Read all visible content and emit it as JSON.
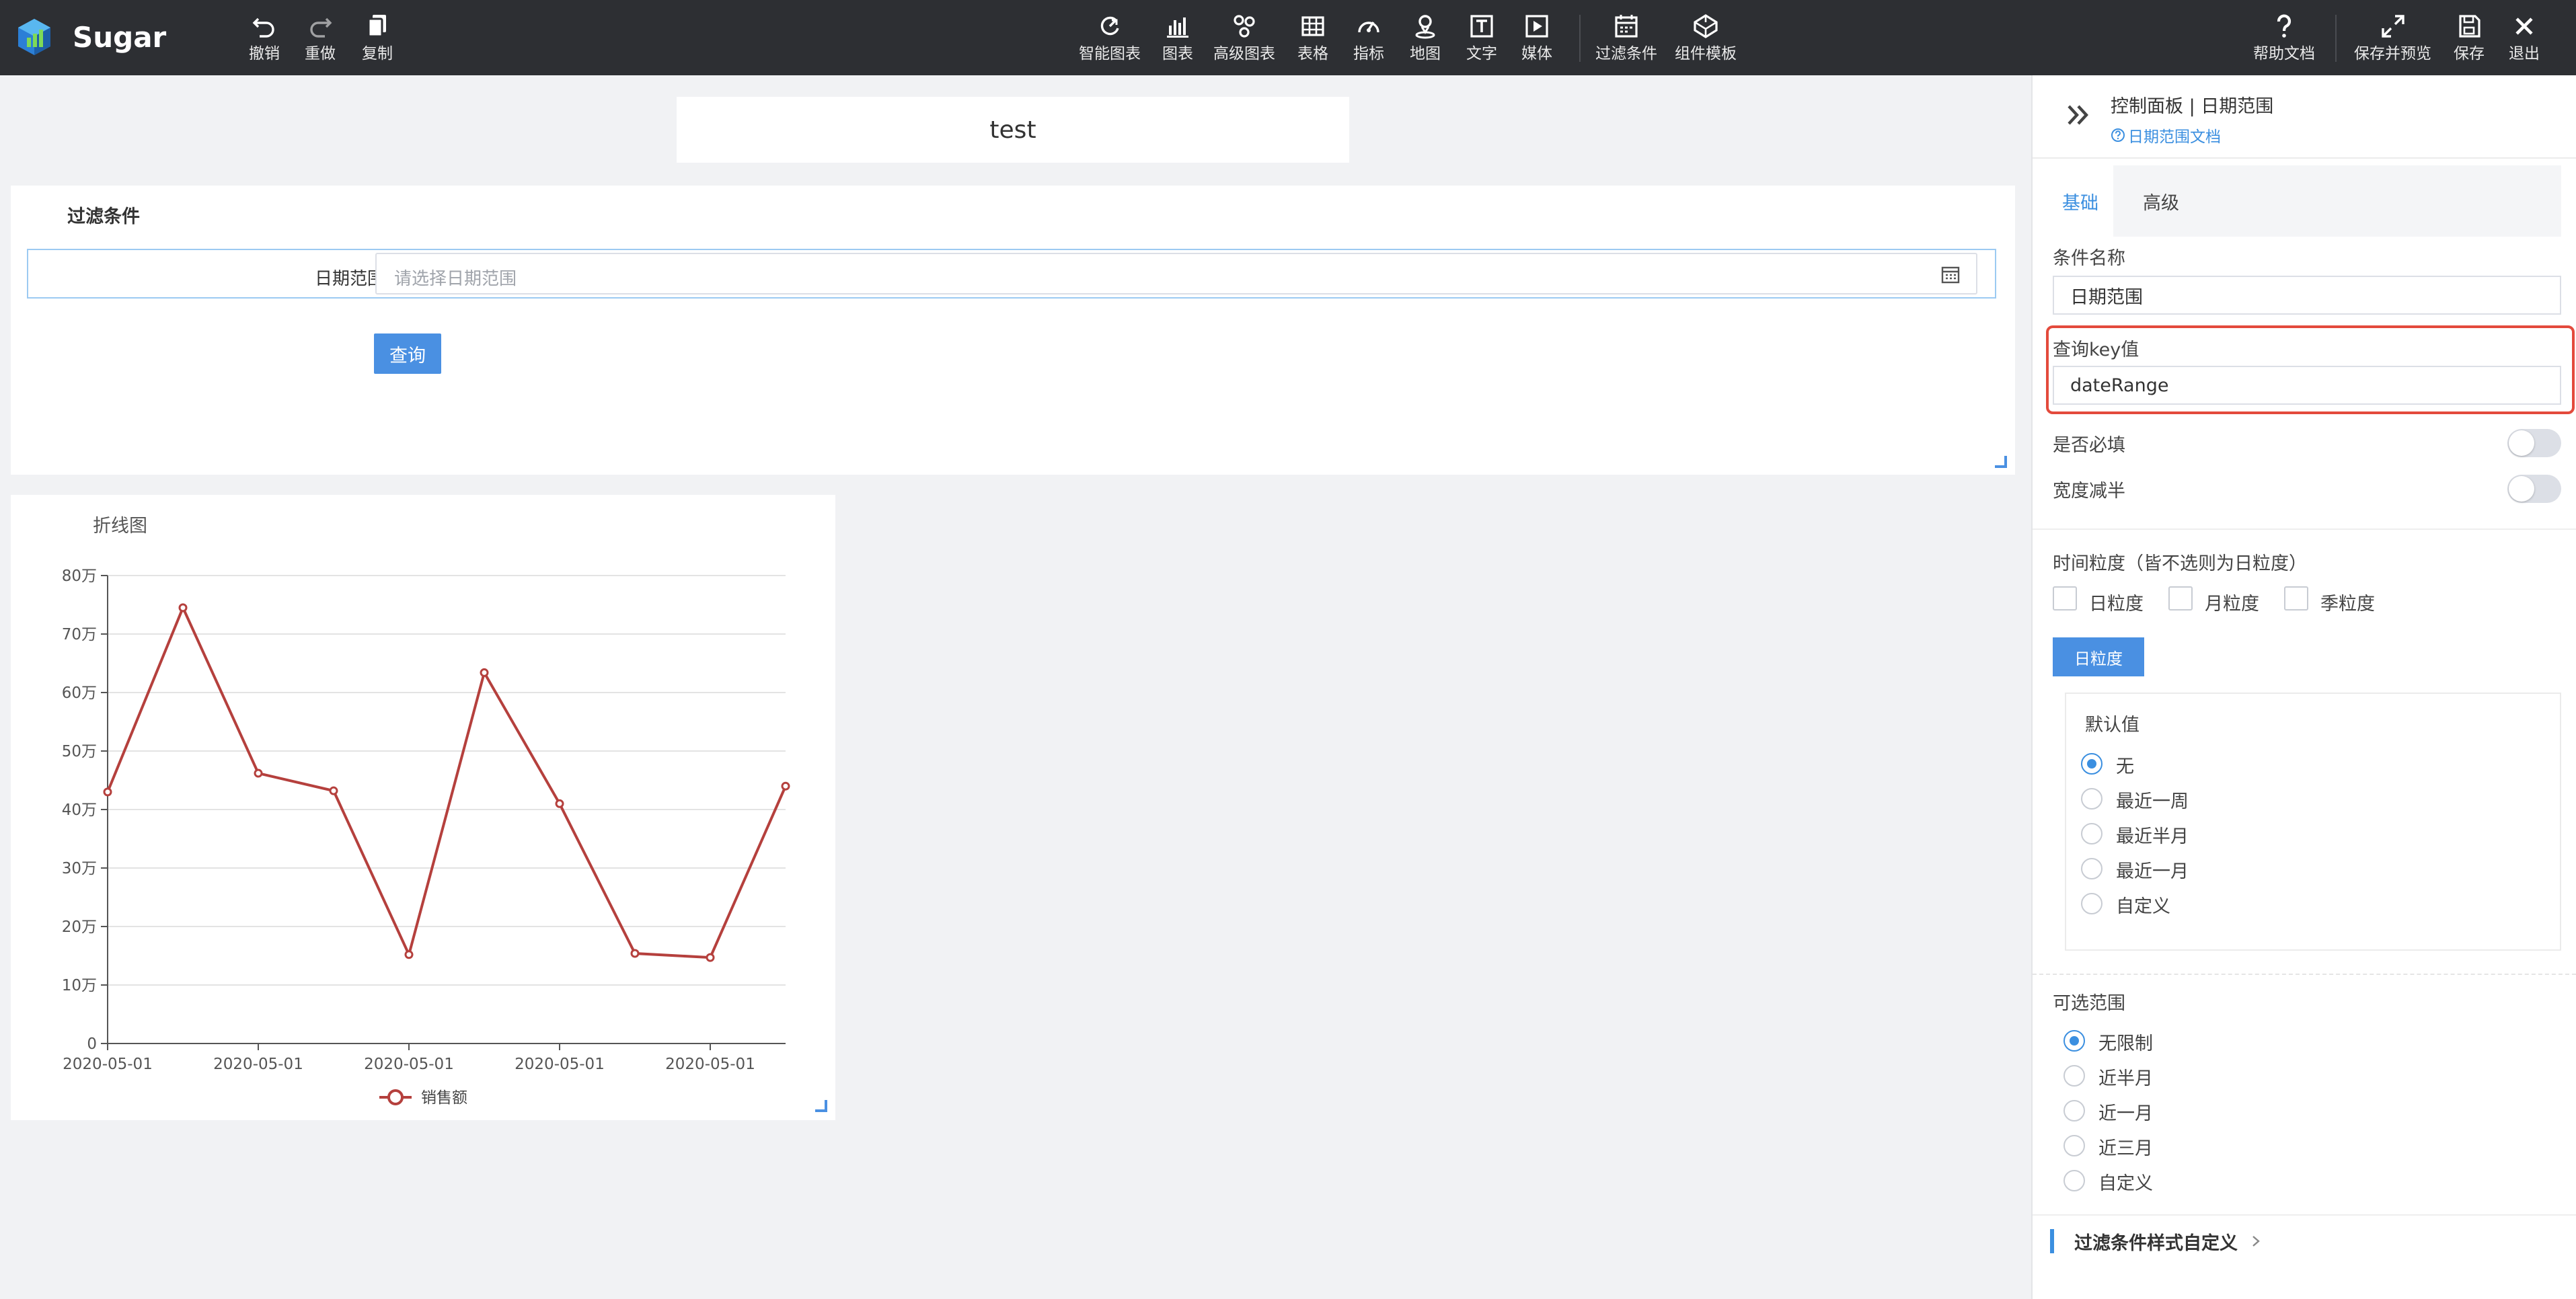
{
  "app": {
    "name": "Sugar"
  },
  "toolbar": {
    "history": [
      {
        "label": "撤销",
        "icon": "undo-icon"
      },
      {
        "label": "重做",
        "icon": "redo-icon"
      },
      {
        "label": "复制",
        "icon": "copy-icon"
      }
    ],
    "components": [
      {
        "label": "智能图表",
        "icon": "smart-chart-icon"
      },
      {
        "label": "图表",
        "icon": "bar-chart-icon"
      },
      {
        "label": "高级图表",
        "icon": "advanced-chart-icon"
      },
      {
        "label": "表格",
        "icon": "table-icon"
      },
      {
        "label": "指标",
        "icon": "gauge-icon"
      },
      {
        "label": "地图",
        "icon": "map-pin-icon"
      },
      {
        "label": "文字",
        "icon": "text-icon"
      },
      {
        "label": "媒体",
        "icon": "media-icon"
      },
      {
        "label": "过滤条件",
        "icon": "filter-calendar-icon"
      },
      {
        "label": "组件模板",
        "icon": "template-icon"
      }
    ],
    "right": [
      {
        "label": "帮助文档",
        "icon": "help-icon"
      },
      {
        "label": "保存并预览",
        "icon": "expand-icon"
      },
      {
        "label": "保存",
        "icon": "save-icon"
      },
      {
        "label": "退出",
        "icon": "close-icon"
      }
    ]
  },
  "canvas": {
    "title": "test",
    "filter": {
      "title": "过滤条件",
      "date_label": "日期范围",
      "date_placeholder": "请选择日期范围",
      "query_label": "查询"
    }
  },
  "chart_data": {
    "type": "line",
    "title": "折线图",
    "x": [
      "2020-05-01",
      "2020-05-01",
      "2020-05-01",
      "2020-05-01",
      "2020-05-01",
      "2020-05-01",
      "2020-05-01",
      "2020-05-01",
      "2020-05-01",
      "2020-05-01"
    ],
    "x_tick_labels": [
      "2020-05-01",
      "2020-05-01",
      "2020-05-01",
      "2020-05-01",
      "2020-05-01"
    ],
    "y_tick_labels": [
      "0",
      "10万",
      "20万",
      "30万",
      "40万",
      "50万",
      "60万",
      "70万",
      "80万"
    ],
    "ylim": [
      0,
      800000
    ],
    "series": [
      {
        "name": "销售额",
        "color": "#b5403d",
        "values": [
          430000,
          745000,
          462000,
          432000,
          152000,
          634000,
          410000,
          154000,
          147000,
          440000
        ]
      }
    ],
    "grid": true,
    "legend": "bottom-center"
  },
  "panel": {
    "path": "控制面板 | 日期范围",
    "doc_link": "日期范围文档",
    "tabs": {
      "basic": "基础",
      "advanced": "高级"
    },
    "name_label": "条件名称",
    "name_value": "日期范围",
    "key_label": "查询key值",
    "key_value": "dateRange",
    "required_label": "是否必填",
    "half_width_label": "宽度减半",
    "granularity_label": "时间粒度（皆不选则为日粒度）",
    "granularity_options": [
      "日粒度",
      "月粒度",
      "季粒度"
    ],
    "granularity_tag": "日粒度",
    "default_label": "默认值",
    "default_options": [
      "无",
      "最近一周",
      "最近半月",
      "最近一月",
      "自定义"
    ],
    "range_label": "可选范围",
    "range_options": [
      "无限制",
      "近半月",
      "近一月",
      "近三月",
      "自定义"
    ],
    "style_label": "过滤条件样式自定义"
  }
}
